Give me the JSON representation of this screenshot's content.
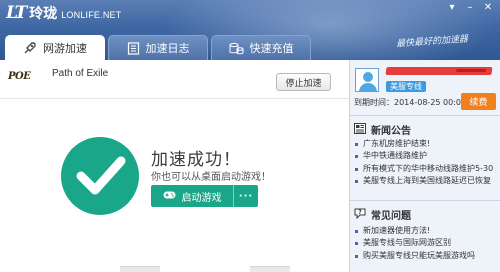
{
  "app": {
    "logo_mark": "LT",
    "name_cn": "玲珑",
    "domain": "LONLIFE.NET",
    "slogan": "最快最好的加速器"
  },
  "window_controls": [
    "menu-icon",
    "minimize-icon",
    "close-icon"
  ],
  "tabs": [
    {
      "label": "网游加速",
      "icon": "rocket-icon",
      "active": true
    },
    {
      "label": "加速日志",
      "icon": "log-icon",
      "active": false
    },
    {
      "label": "快速充值",
      "icon": "coins-icon",
      "active": false
    }
  ],
  "game": {
    "logo_text": "POE",
    "name": "Path of Exile",
    "stop_label": "停止加速"
  },
  "status": {
    "title": "加速成功！",
    "subtitle": "你也可以从桌面启动游戏！",
    "launch_label": "启动游戏",
    "more_label": "···"
  },
  "account": {
    "badge": "美服专线",
    "expire_label": "到期时间：",
    "expire_value": "2014-08-25 00:00",
    "renew_label": "续费"
  },
  "news": {
    "title": "新闻公告",
    "items": [
      "广东机房维护结束!",
      "华中铁通线路维护",
      "所有模式下的华中移动线路维护5-30",
      "美服专线上海到美国线路延迟已恢复"
    ]
  },
  "faq": {
    "title": "常见问题",
    "items": [
      "新加速器使用方法!",
      "美服专线与国际网游区别",
      "购买美服专线只能玩美服游戏吗"
    ]
  },
  "colors": {
    "accent_green": "#1aa789",
    "renew_orange": "#f0811e",
    "badge_blue": "#3b9ae1",
    "title_blue": "#3f67a3"
  }
}
